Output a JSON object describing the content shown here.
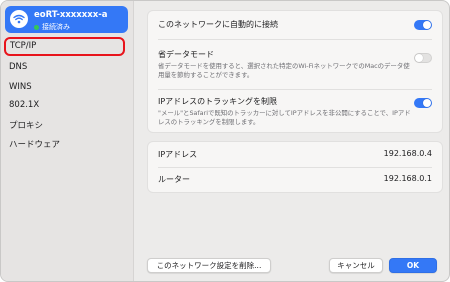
{
  "sidebar": {
    "network": {
      "name": "eoRT-xxxxxxx-a",
      "status": "接続済み",
      "status_color": "#34c759"
    },
    "items": [
      {
        "label": "TCP/IP"
      },
      {
        "label": "DNS"
      },
      {
        "label": "WINS"
      },
      {
        "label": "802.1X"
      },
      {
        "label": "プロキシ"
      },
      {
        "label": "ハードウェア"
      }
    ],
    "selected": "TCP/IP"
  },
  "main": {
    "auto_join": {
      "label": "このネットワークに自動的に接続",
      "enabled": true
    },
    "low_data": {
      "label": "省データモード",
      "description": "省データモードを使用すると、選択された特定のWi-FiネットワークでのMacのデータ使用量を節約することができます。",
      "enabled": false
    },
    "limit_tracking": {
      "label": "IPアドレスのトラッキングを制限",
      "description": "\"メール\"とSafariで既知のトラッカーに対してIPアドレスを非公開にすることで、IPアドレスのトラッキングを制限します。",
      "enabled": true
    },
    "ip_address": {
      "label": "IPアドレス",
      "value": "192.168.0.4"
    },
    "router": {
      "label": "ルーター",
      "value": "192.168.0.1"
    }
  },
  "footer": {
    "forget_label": "このネットワーク設定を削除...",
    "cancel_label": "キャンセル",
    "ok_label": "OK"
  },
  "colors": {
    "accent": "#3478f6",
    "highlight": "#e8141c"
  }
}
